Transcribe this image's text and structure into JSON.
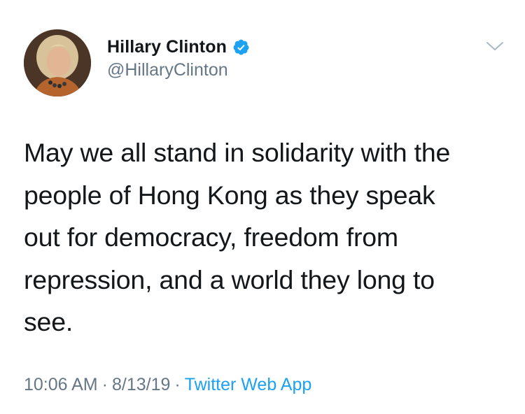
{
  "author": {
    "display_name": "Hillary Clinton",
    "handle": "@HillaryClinton",
    "verified": true
  },
  "tweet": {
    "text": "May we all stand in solidarity with the\npeople of Hong Kong as they speak\nout for democracy, freedom from\nrepression, and a world they long to\nsee.",
    "time": "10:06 AM",
    "date": "8/13/19",
    "separator": "·",
    "source": "Twitter Web App"
  },
  "icons": {
    "verified": "verified-badge-icon",
    "menu": "chevron-down-icon"
  },
  "colors": {
    "text": "#14171a",
    "secondary": "#657786",
    "link": "#1da1f2",
    "verified": "#1da1f2"
  }
}
